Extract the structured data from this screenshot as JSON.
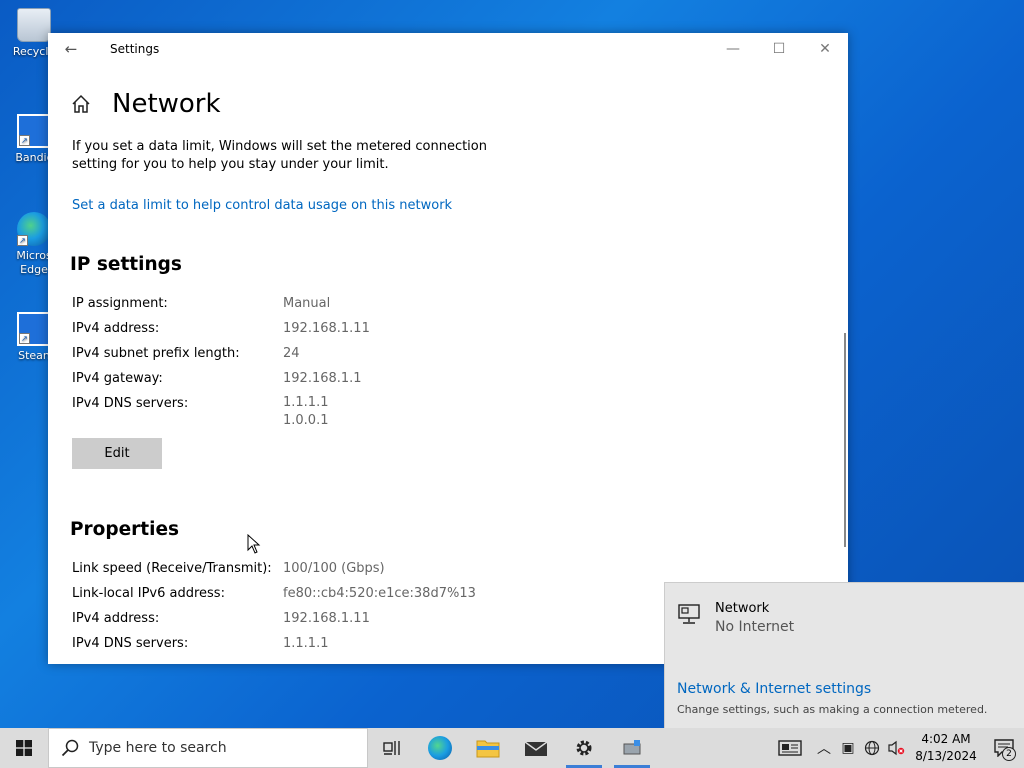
{
  "desktop": {
    "icons": [
      {
        "label": "Recycle"
      },
      {
        "label": "Bandic"
      },
      {
        "label": "Micros Edge"
      },
      {
        "label": "Stean"
      }
    ]
  },
  "window": {
    "title": "Settings",
    "page_title": "Network",
    "metered_text": "If you set a data limit, Windows will set the metered connection setting for you to help you stay under your limit.",
    "data_limit_link": "Set a data limit to help control data usage on this network",
    "ip_settings": {
      "heading": "IP settings",
      "rows": [
        {
          "label": "IP assignment:",
          "value": "Manual"
        },
        {
          "label": "IPv4 address:",
          "value": "192.168.1.11"
        },
        {
          "label": "IPv4 subnet prefix length:",
          "value": "24"
        },
        {
          "label": "IPv4 gateway:",
          "value": "192.168.1.1"
        },
        {
          "label": "IPv4 DNS servers:",
          "value": "1.1.1.1",
          "value2": "1.0.0.1"
        }
      ],
      "edit_label": "Edit"
    },
    "properties": {
      "heading": "Properties",
      "rows": [
        {
          "label": "Link speed (Receive/Transmit):",
          "value": "100/100 (Gbps)"
        },
        {
          "label": "Link-local IPv6 address:",
          "value": "fe80::cb4:520:e1ce:38d7%13"
        },
        {
          "label": "IPv4 address:",
          "value": "192.168.1.11"
        },
        {
          "label": "IPv4 DNS servers:",
          "value": "1.1.1.1"
        }
      ]
    }
  },
  "flyout": {
    "network_name": "Network",
    "network_status": "No Internet",
    "settings_link": "Network & Internet settings",
    "settings_desc": "Change settings, such as making a connection metered."
  },
  "taskbar": {
    "search_placeholder": "Type here to search",
    "clock_time": "4:02 AM",
    "clock_date": "8/13/2024",
    "notification_count": "2"
  }
}
